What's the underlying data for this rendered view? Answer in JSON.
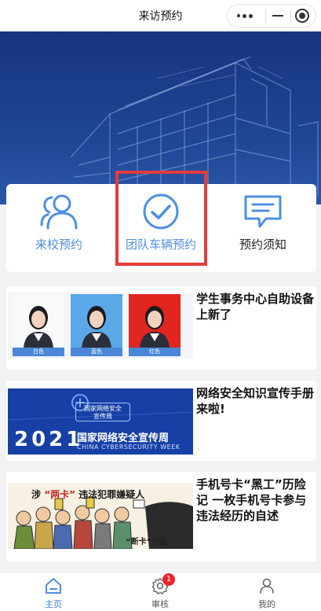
{
  "header": {
    "title": "来访预约"
  },
  "menu": {
    "items": [
      {
        "label": "来校预约"
      },
      {
        "label": "团队车辆预约"
      },
      {
        "label": "预约须知"
      }
    ]
  },
  "news": [
    {
      "title": "学生事务中心自助设备上新了",
      "thumb_captions": [
        "白色",
        "蓝色",
        "红色"
      ]
    },
    {
      "title": "网络安全知识宣传手册来啦!",
      "thumb_year": "2021",
      "thumb_badge_line1": "国家网络安全",
      "thumb_badge_line2": "宣传周",
      "thumb_zh": "国家网络安全宣传周",
      "thumb_en": "CHINA CYBERSECURITY WEEK"
    },
    {
      "title": "手机号卡“黑工”历险记 一枚手机号卡参与违法经历的自述",
      "thumb_title_a": "涉",
      "thumb_title_quote": "“两卡”",
      "thumb_title_b": "违法犯罪嫌疑人",
      "thumb_action": "“断卡”行动"
    }
  ],
  "tabbar": {
    "items": [
      {
        "label": "主页"
      },
      {
        "label": "审核",
        "badge": "1"
      },
      {
        "label": "我的"
      }
    ]
  },
  "colors": {
    "accent": "#3d7fe0",
    "icon_blue": "#4f8fe0",
    "highlight": "#e53b3b",
    "banner": "#1f4594"
  }
}
